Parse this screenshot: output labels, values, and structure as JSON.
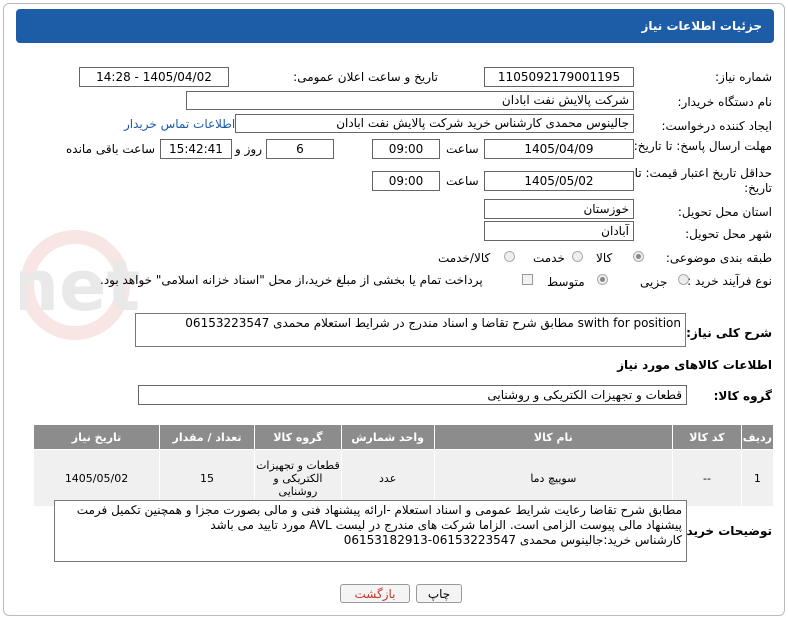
{
  "header": {
    "title": "جزئیات اطلاعات نیاز"
  },
  "form": {
    "need_number_label": "شماره نیاز:",
    "need_number": "1105092179001195",
    "announce_label": "تاریخ و ساعت اعلان عمومی:",
    "announce_value": "1405/04/02 - 14:28",
    "buyer_org_label": "نام دستگاه خریدار:",
    "buyer_org": "شرکت پالایش نفت ابادان",
    "creator_label": "ایجاد کننده درخواست:",
    "creator": "جالینوس محمدی کارشناس خرید  شرکت پالایش نفت ابادان",
    "contact_link": "اطلاعات تماس خریدار",
    "reply_deadline_label": "مهلت ارسال پاسخ: تا تاریخ:",
    "reply_date": "1405/04/09",
    "time_label": "ساعت",
    "reply_time": "09:00",
    "days_value": "6",
    "days_label": "روز و",
    "remaining_time": "15:42:41",
    "remaining_label": "ساعت باقی مانده",
    "price_deadline_label": "حداقل تاریخ اعتبار قیمت: تا تاریخ:",
    "price_date": "1405/05/02",
    "price_time": "09:00",
    "province_label": "استان محل تحویل:",
    "province": "خوزستان",
    "city_label": "شهر محل تحویل:",
    "city": "آبادان",
    "category_label": "طبقه بندی موضوعی:",
    "category_options": [
      "کالا",
      "خدمت",
      "کالا/خدمت"
    ],
    "process_label": "نوع فرآیند خرید :",
    "process_options": [
      "جزیی",
      "متوسط"
    ],
    "payment_note": "پرداخت تمام یا بخشی از مبلغ خرید،از محل \"اسناد خزانه اسلامی\" خواهد بود."
  },
  "description": {
    "label": "شرح کلی نیاز:",
    "text": "swith for position مطابق شرح تقاضا و اسناد مندرج در شرایط استعلام محمدی 06153223547"
  },
  "goods": {
    "section_title": "اطلاعات کالاهای مورد نیاز",
    "group_label": "گروه کالا:",
    "group_value": "قطعات و تجهیزات الکتریکی و روشنایی",
    "columns": [
      "ردیف",
      "کد کالا",
      "نام کالا",
      "واحد شمارش",
      "گروه کالا",
      "تعداد / مقدار",
      "تاریخ نیاز"
    ],
    "rows": [
      {
        "row": "1",
        "code": "--",
        "name": "سوییچ دما",
        "unit": "عدد",
        "group": "قطعات و تجهیزات الکتریکی و روشنایی",
        "qty": "15",
        "date": "1405/05/02"
      }
    ]
  },
  "buyer_notes": {
    "label": "توضیحات خریدار:",
    "text": "مطابق شرح تقاضا رعایت شرایط عمومی و اسناد استعلام -ارائه پیشنهاد فنی و مالی بصورت مجزا و همچنین تکمیل فرمت پیشنهاد مالی پیوست الزامی است. الزاما شرکت های مندرج  در لیست AVL مورد تایید می باشد\nکارشناس خرید:جالینوس محمدی 06153223547-06153182913"
  },
  "buttons": {
    "print": "چاپ",
    "back": "بازگشت"
  },
  "watermark": {
    "text": "AriaTender.net"
  },
  "colors": {
    "header": "#1d5ca7",
    "table_header": "#8c8c8c",
    "back_text": "#c0392b"
  }
}
